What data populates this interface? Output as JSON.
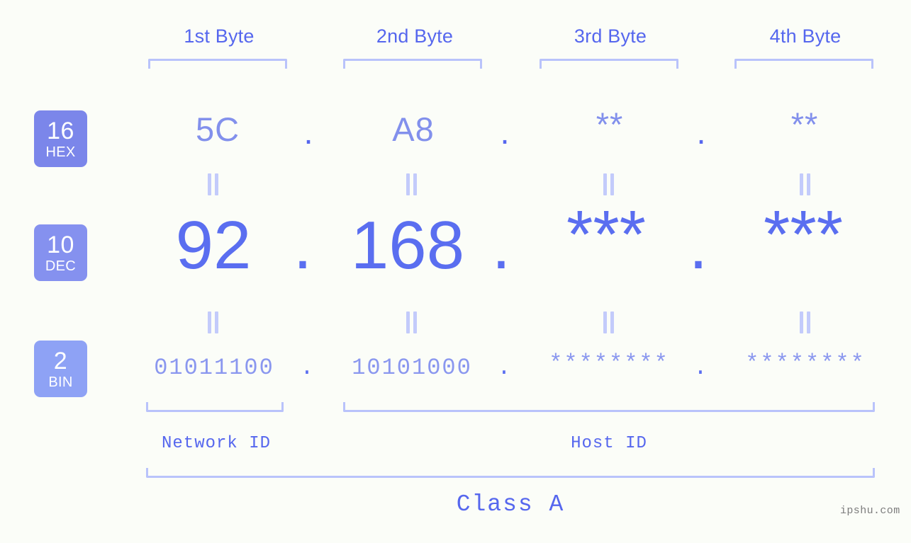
{
  "page": {
    "background_color": "#fbfdf8",
    "accent_color": "#5667ee",
    "bracket_color": "#b9c3fb",
    "watermark": "ipshu.com"
  },
  "byte_headers": [
    {
      "label": "1st Byte"
    },
    {
      "label": "2nd Byte"
    },
    {
      "label": "3rd Byte"
    },
    {
      "label": "4th Byte"
    }
  ],
  "bases": [
    {
      "num": "16",
      "name": "HEX",
      "color": "#7b86ea"
    },
    {
      "num": "10",
      "name": "DEC",
      "color": "#8591ef"
    },
    {
      "num": "2",
      "name": "BIN",
      "color": "#8ea2f5"
    }
  ],
  "rows": {
    "hex": {
      "values": [
        "5C",
        "A8",
        "**",
        "**"
      ],
      "separators": [
        ".",
        ".",
        "."
      ]
    },
    "dec": {
      "values": [
        "92",
        "168",
        "***",
        "***"
      ],
      "separators": [
        ".",
        ".",
        "."
      ]
    },
    "bin": {
      "values": [
        "01011100",
        "10101000",
        "********",
        "********"
      ],
      "separators": [
        ".",
        ".",
        "."
      ]
    }
  },
  "connector": "||",
  "segments": {
    "network_id": "Network ID",
    "host_id": "Host ID",
    "class": "Class A"
  }
}
